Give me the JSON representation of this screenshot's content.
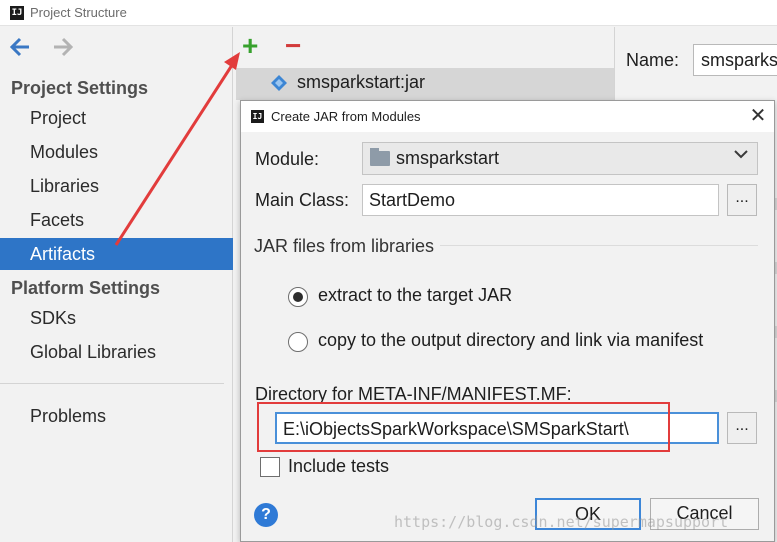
{
  "window": {
    "title": "Project Structure",
    "icon": "intellij-icon"
  },
  "nav": {
    "back_icon": "arrow-left-icon",
    "forward_icon": "arrow-right-icon"
  },
  "sidebar": {
    "project_settings_header": "Project Settings",
    "project_settings_items": [
      "Project",
      "Modules",
      "Libraries",
      "Facets",
      "Artifacts"
    ],
    "platform_settings_header": "Platform Settings",
    "platform_settings_items": [
      "SDKs",
      "Global Libraries"
    ],
    "problems": "Problems",
    "selected": "Artifacts"
  },
  "toolbar": {
    "add": "+",
    "remove": "−"
  },
  "artifacts": {
    "items": [
      "smsparkstart:jar"
    ]
  },
  "details": {
    "name_label": "Name:",
    "name_value": "smsparkstart:jar"
  },
  "dialog": {
    "title": "Create JAR from Modules",
    "close": "✕",
    "module_label": "Module:",
    "module_value": "smsparkstart",
    "main_class_label": "Main Class:",
    "main_class_value": "StartDemo",
    "browse": "...",
    "jar_group_title": "JAR files from libraries",
    "radio_extract": "extract to the target JAR",
    "radio_copy": "copy to the output directory and link via manifest",
    "radio_selected": "extract to the target JAR",
    "manifest_label": "Directory for META-INF/MANIFEST.MF:",
    "manifest_value": "E:\\iObjectsSparkWorkspace\\SMSparkStart\\",
    "include_tests": "Include tests",
    "include_tests_checked": false,
    "help": "?",
    "ok": "OK",
    "cancel": "Cancel"
  },
  "watermark": "https://blog.csdn.net/supermapsupport",
  "colors": {
    "selection": "#2e75c7",
    "add": "#37a12d",
    "remove": "#d23b3b",
    "annotation": "#e23c3c",
    "focus": "#4a90d9"
  }
}
